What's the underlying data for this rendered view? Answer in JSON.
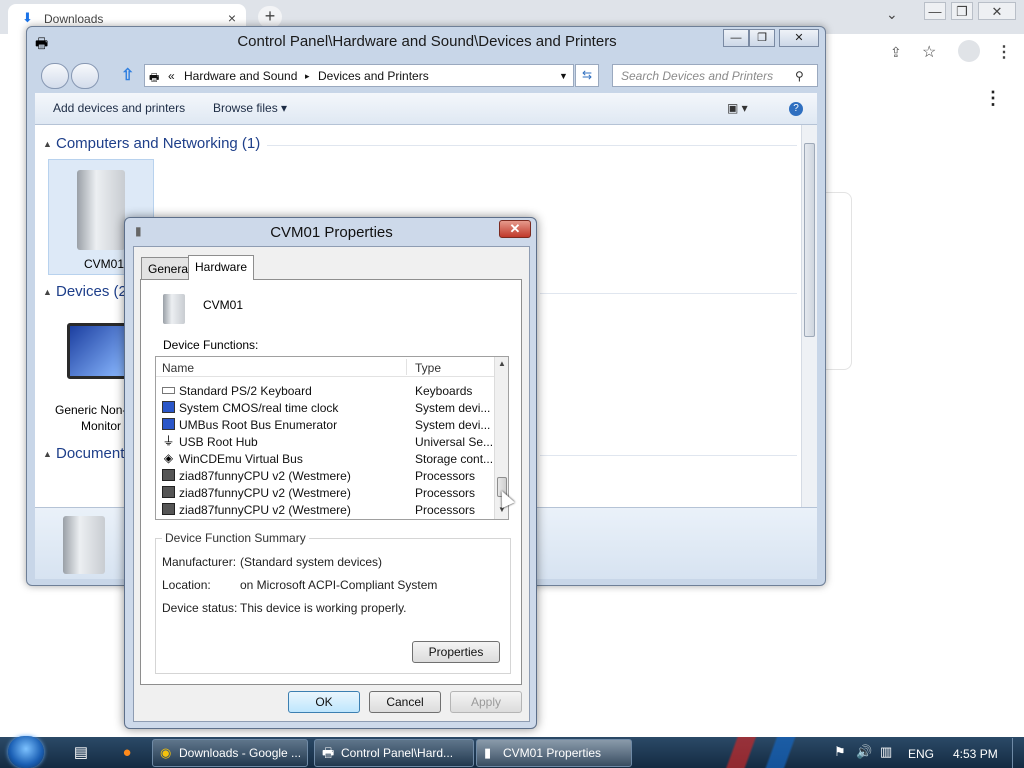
{
  "chrome": {
    "tab_title": "Downloads",
    "tab_close": "×",
    "new_tab": "+",
    "tab_search": "⌄",
    "minimize": "—",
    "restore": "❐",
    "close": "✕",
    "menu": "⋮",
    "omni_placeholder": ""
  },
  "cp": {
    "title": "Control Panel\\Hardware and Sound\\Devices and Printers",
    "address": {
      "sep": "«",
      "crumb1": "Hardware and Sound",
      "arrow": "▸",
      "crumb2": "Devices and Printers"
    },
    "search_placeholder": "Search Devices and Printers",
    "toolbar": {
      "add_label": "Add devices and printers",
      "browse_label": "Browse files ▾"
    },
    "groups": [
      {
        "label": "Computers and Networking (1)"
      },
      {
        "label": "Devices (2"
      },
      {
        "label": "Document"
      }
    ],
    "devices": {
      "computer": "CVM01",
      "monitor": "Generic Non-",
      "monitor2": "Monitor"
    }
  },
  "dialog": {
    "title": "CVM01 Properties",
    "tabs": [
      "General",
      "Hardware"
    ],
    "device_name": "CVM01",
    "functions_label": "Device Functions:",
    "columns": {
      "name": "Name",
      "type": "Type"
    },
    "rows": [
      {
        "name": "Standard PS/2 Keyboard",
        "type": "Keyboards",
        "icon": "keyboard-icon"
      },
      {
        "name": "System CMOS/real time clock",
        "type": "System devi...",
        "icon": "system-device-icon"
      },
      {
        "name": "UMBus Root Bus Enumerator",
        "type": "System devi...",
        "icon": "system-device-icon"
      },
      {
        "name": "USB Root Hub",
        "type": "Universal Se...",
        "icon": "usb-icon"
      },
      {
        "name": "WinCDEmu Virtual Bus",
        "type": "Storage cont...",
        "icon": "storage-controller-icon"
      },
      {
        "name": "ziad87funnyCPU v2 (Westmere)",
        "type": "Processors",
        "icon": "processor-icon"
      },
      {
        "name": "ziad87funnyCPU v2 (Westmere)",
        "type": "Processors",
        "icon": "processor-icon"
      },
      {
        "name": "ziad87funnyCPU v2 (Westmere)",
        "type": "Processors",
        "icon": "processor-icon"
      }
    ],
    "summary": {
      "caption": "Device Function Summary",
      "manufacturer_label": "Manufacturer:",
      "manufacturer": "(Standard system devices)",
      "location_label": "Location:",
      "location": "on Microsoft ACPI-Compliant System",
      "status_label": "Device status:",
      "status": "This device is working properly."
    },
    "properties_button": "Properties",
    "ok": "OK",
    "cancel": "Cancel",
    "apply": "Apply"
  },
  "taskbar": {
    "buttons": [
      "Downloads - Google ...",
      "Control Panel\\Hard...",
      "CVM01 Properties"
    ],
    "language": "ENG",
    "time": "4:53 PM"
  }
}
